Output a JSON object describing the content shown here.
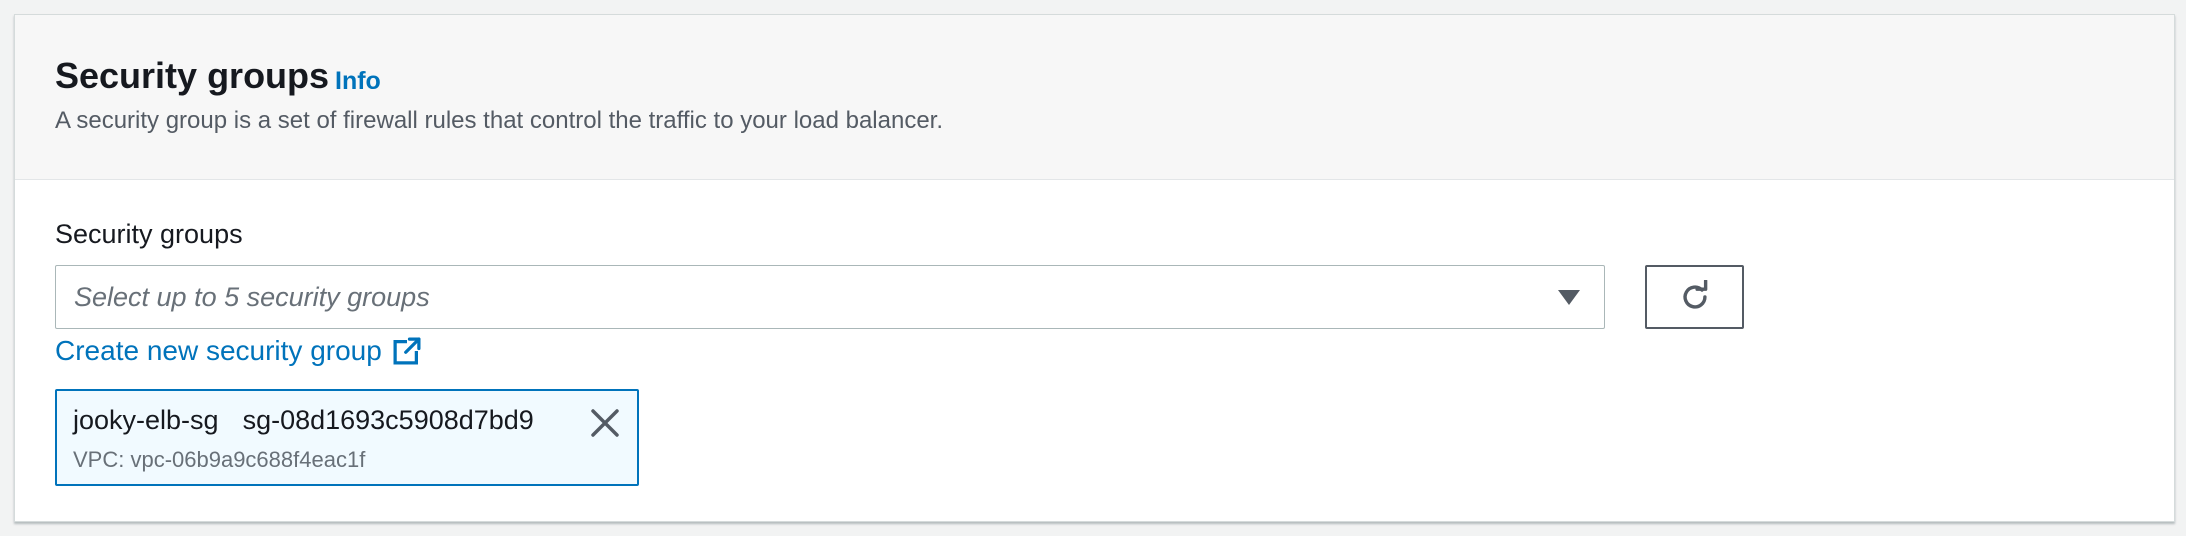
{
  "section": {
    "title": "Security groups",
    "info_label": "Info",
    "description": "A security group is a set of firewall rules that control the traffic to your load balancer."
  },
  "field": {
    "label": "Security groups",
    "placeholder": "Select up to 5 security groups",
    "create_link": "Create new security group"
  },
  "selected_groups": [
    {
      "name": "jooky-elb-sg",
      "id": "sg-08d1693c5908d7bd9",
      "vpc": "VPC: vpc-06b9a9c688f4eac1f"
    }
  ],
  "icons": {
    "dropdown": "caret-down-icon",
    "refresh": "refresh-icon",
    "external": "external-link-icon",
    "remove": "close-icon"
  },
  "colors": {
    "link": "#0073bb",
    "text": "#16191f",
    "token_bg": "#f1faff",
    "token_border": "#0073bb"
  }
}
